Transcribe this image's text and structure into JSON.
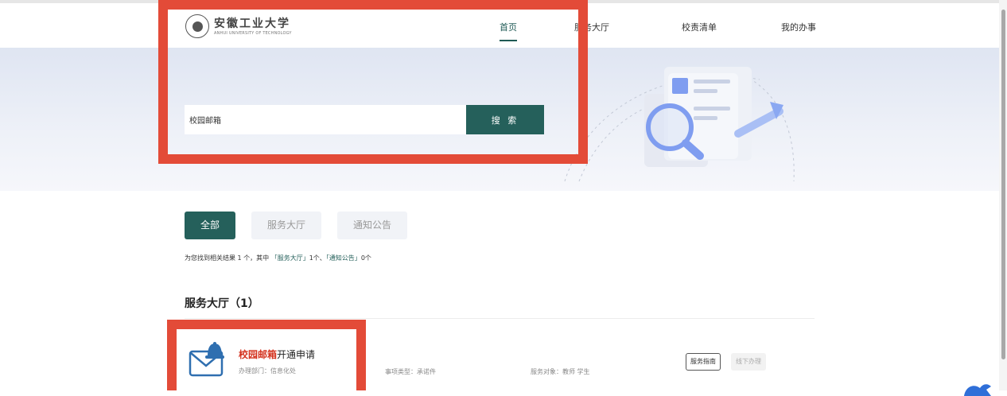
{
  "header": {
    "logo": {
      "name_cn": "安徽工业大学",
      "name_en": "ANHUI UNIVERSITY OF TECHNOLOGY",
      "icon": "university-seal-icon"
    },
    "nav": [
      {
        "label": "首页",
        "active": true
      },
      {
        "label": "服务大厅",
        "active": false
      },
      {
        "label": "校责清单",
        "active": false
      },
      {
        "label": "我的办事",
        "active": false
      }
    ]
  },
  "search": {
    "value": "校园邮箱",
    "button_label": "搜 索"
  },
  "hero": {
    "illustration_icon": "search-document-icon"
  },
  "results": {
    "tabs": [
      {
        "label": "全部",
        "active": true
      },
      {
        "label": "服务大厅",
        "active": false
      },
      {
        "label": "通知公告",
        "active": false
      }
    ],
    "summary": {
      "prefix": "为您找到相关结果 1 个，其中 ",
      "part1": "「服务大厅」",
      "mid": "1个、",
      "part2": "「通知公告」",
      "suffix": "0个"
    },
    "section_title": "服务大厅（1）",
    "items": [
      {
        "icon": "mail-bell-icon",
        "title_highlight": "校园邮箱",
        "title_rest": "开通申请",
        "department": "办理部门：信息化处",
        "type": "事项类型：承诺件",
        "target": "服务对象：教师 学生",
        "guide_button": "服务指南",
        "offline_button": "线下办理"
      }
    ]
  },
  "colors": {
    "primary": "#25605b",
    "highlight_red": "#d4321e",
    "annotation_red": "#e34b38"
  }
}
